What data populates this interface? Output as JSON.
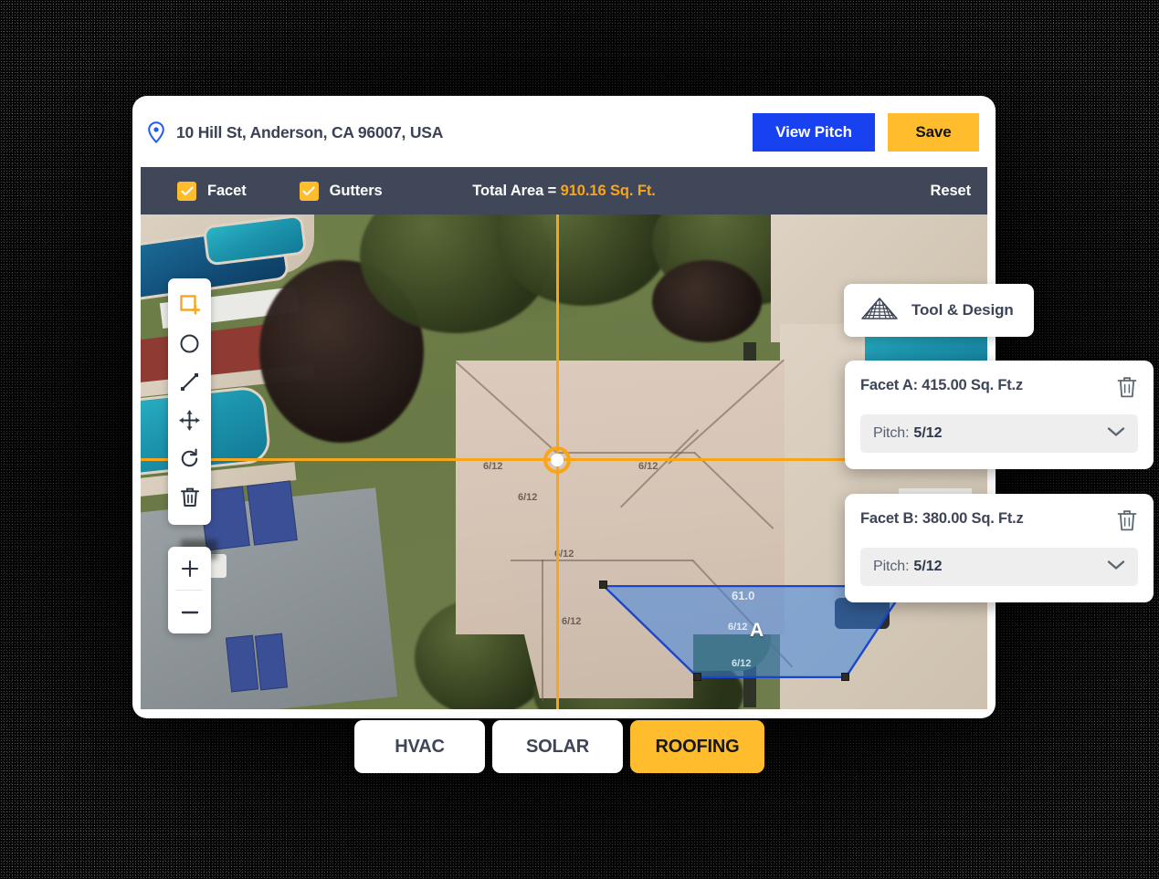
{
  "header": {
    "pin_icon": "location-pin-icon",
    "address": "10 Hill St, Anderson, CA 96007, USA",
    "view_pitch_label": "View Pitch",
    "save_label": "Save",
    "view_pitch_color": "#1841f0",
    "save_color": "#ffbd2e"
  },
  "toolbar": {
    "facet_label": "Facet",
    "facet_checked": true,
    "gutters_label": "Gutters",
    "gutters_checked": true,
    "total_label": "Total Area = ",
    "total_value": "910.16 Sq. Ft.",
    "total_value_color": "#f9a51a",
    "reset_label": "Reset",
    "background_color": "#3f4758"
  },
  "tools": {
    "items": [
      {
        "name": "add-rectangle-icon",
        "active": true
      },
      {
        "name": "circle-icon",
        "active": false
      },
      {
        "name": "line-icon",
        "active": false
      },
      {
        "name": "move-icon",
        "active": false
      },
      {
        "name": "rotate-icon",
        "active": false
      },
      {
        "name": "delete-icon",
        "active": false
      }
    ],
    "zoom_in": "+",
    "zoom_out": "−"
  },
  "tool_design": {
    "icon": "roof-icon",
    "label": "Tool &  Design"
  },
  "facets": [
    {
      "id": "A",
      "title": "Facet A: 415.00 Sq. Ft.z",
      "pitch_label": "Pitch:",
      "pitch_value": "5/12",
      "delete_icon": "trash-icon",
      "chevron_icon": "chevron-down-icon"
    },
    {
      "id": "B",
      "title": "Facet B: 380.00 Sq. Ft.z",
      "pitch_label": "Pitch:",
      "pitch_value": "5/12",
      "delete_icon": "trash-icon",
      "chevron_icon": "chevron-down-icon"
    }
  ],
  "map_overlay": {
    "selected_facet_letter": "A",
    "selected_facet_color": "#3882e2",
    "selected_facet_outline": "#1c46c8",
    "crosshair_color": "#f9a51a",
    "edge_dimension": "61.0",
    "pitch_marks": [
      "6/12",
      "6/12",
      "6/12",
      "6/12",
      "6/12",
      "6/12",
      "6/12"
    ]
  },
  "tabs": [
    {
      "label": "HVAC",
      "active": false
    },
    {
      "label": "SOLAR",
      "active": false
    },
    {
      "label": "ROOFING",
      "active": true
    }
  ]
}
